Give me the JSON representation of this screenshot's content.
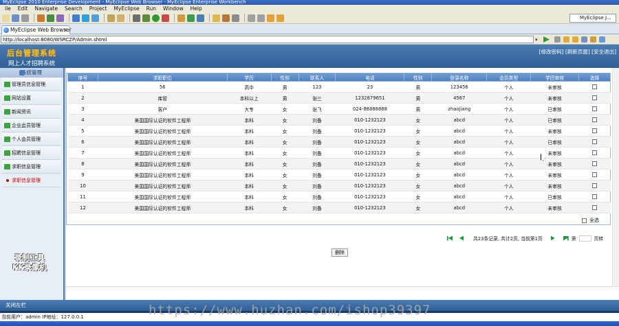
{
  "window": {
    "title": "MyEclipse 2010 Enterprise Development - MyEclipse Web Browser - MyEclipse Enterprise Workbench"
  },
  "menu": [
    "ile",
    "Edit",
    "Navigate",
    "Search",
    "Project",
    "MyEclipse",
    "Run",
    "Window",
    "Help"
  ],
  "perspective": {
    "label": "MyEclipse J..."
  },
  "tab": {
    "label": "MyEclipse Web Browser",
    "close": "×"
  },
  "url": {
    "value": "http://localhost:8080/WSRCZP/Admin.shtml",
    "dropdown": "▾"
  },
  "app": {
    "logo": "后台管理系统",
    "subtitle": "网上人才招聘系统",
    "links": "[修改密码] [刷新页面] [安全退出]",
    "footer": "关闭左栏"
  },
  "sidebar": {
    "header": "系统管理",
    "items": [
      {
        "label": "管理员信息管理"
      },
      {
        "label": "网站设置"
      },
      {
        "label": "新闻资讯"
      },
      {
        "label": "企业会员管理"
      },
      {
        "label": "个人会员管理"
      },
      {
        "label": "招聘信息管理"
      },
      {
        "label": "求职信息管理"
      },
      {
        "label": "求职信息管理",
        "active": true
      }
    ]
  },
  "table": {
    "headers": [
      "序号",
      "求职职位",
      "学历",
      "性别",
      "联系人",
      "电话",
      "性别",
      "登录名称",
      "会员类型",
      "学历审核",
      "选择"
    ],
    "rows": [
      [
        "1",
        "56",
        "高中",
        "男",
        "123",
        "23",
        "男",
        "123456",
        "个人",
        "未审核"
      ],
      [
        "2",
        "库管",
        "本科以上",
        "男",
        "张三",
        "1232879651",
        "男",
        "4567",
        "个人",
        "未审核"
      ],
      [
        "3",
        "客户",
        "大专",
        "女",
        "张飞",
        "024-88888888",
        "男",
        "zhaojiang",
        "个人",
        "已审核"
      ],
      [
        "4",
        "美国国际认证的软件工程师",
        "本科",
        "女",
        "刘备",
        "010-1232123",
        "女",
        "abcd",
        "个人",
        "已审核"
      ],
      [
        "5",
        "美国国际认证的软件工程师",
        "本科",
        "女",
        "刘备",
        "010-1232123",
        "女",
        "abcd",
        "个人",
        "未审核"
      ],
      [
        "6",
        "美国国际认证的软件工程师",
        "本科",
        "女",
        "刘备",
        "010-1232123",
        "女",
        "abcd",
        "个人",
        "已审核"
      ],
      [
        "7",
        "美国国际认证的软件工程师",
        "本科",
        "女",
        "刘备",
        "010-1232123",
        "女",
        "abcd",
        "个人",
        "未审核"
      ],
      [
        "8",
        "美国国际认证的软件工程师",
        "本科",
        "女",
        "刘备",
        "010-1232123",
        "女",
        "abcd",
        "个人",
        "未审核"
      ],
      [
        "9",
        "美国国际认证的软件工程师",
        "本科",
        "女",
        "刘备",
        "010-1232123",
        "女",
        "abcd",
        "个人",
        "未审核"
      ],
      [
        "10",
        "美国国际认证的软件工程师",
        "本科",
        "女",
        "刘备",
        "010-1232123",
        "女",
        "abcd",
        "个人",
        "未审核"
      ],
      [
        "11",
        "美国国际认证的软件工程师",
        "本科",
        "女",
        "刘备",
        "010-1232123",
        "女",
        "abcd",
        "个人",
        "已审核"
      ],
      [
        "12",
        "美国国际认证的软件工程师",
        "本科",
        "女",
        "刘备",
        "010-1232123",
        "女",
        "abcd",
        "个人",
        "未审核"
      ]
    ],
    "select_all": "全选"
  },
  "pager": {
    "summary": "共23条记录, 共计2页, 当前第1页",
    "goto_label": "第",
    "page_suffix": "页",
    "go_label": "页转"
  },
  "actions": {
    "delete": "删除"
  },
  "status": {
    "text": "当前用户：admin  IP地址：127.0.0.1"
  },
  "watermarks": {
    "recorder": "录制工具",
    "recorder2": "KK录像机",
    "site": "https://www.huzhan.com/ishop39397"
  },
  "colors": {
    "header_blue": "#4a7db4",
    "logo_gold": "#f4c33a",
    "table_header": "#5b8cc9",
    "accent_red": "#c00000"
  }
}
